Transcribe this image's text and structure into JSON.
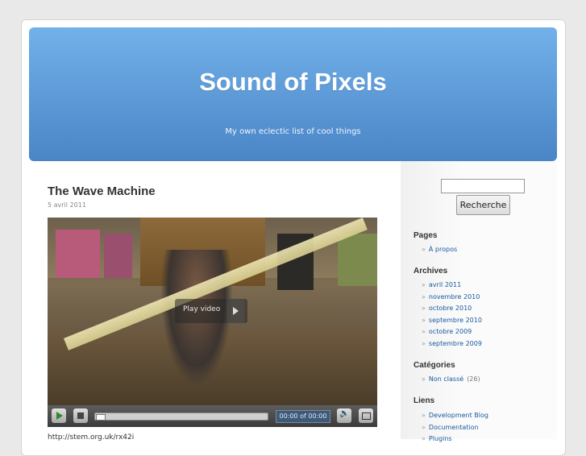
{
  "header": {
    "title": "Sound of Pixels",
    "description": "My own eclectic list of cool things",
    "gradient_top": "#72b1ea",
    "gradient_bottom": "#4a85c6"
  },
  "post": {
    "title": "The Wave Machine",
    "date": "5 avril 2011",
    "video": {
      "overlay_label": "Play video",
      "time_display": "00:00 of 00:00",
      "progress": 0
    },
    "link_text": "http://stem.org.uk/rx42i"
  },
  "sidebar": {
    "search": {
      "value": "",
      "button_label": "Recherche"
    },
    "pages": {
      "title": "Pages",
      "items": [
        {
          "label": "À propos"
        }
      ]
    },
    "archives": {
      "title": "Archives",
      "items": [
        {
          "label": "avril 2011"
        },
        {
          "label": "novembre 2010"
        },
        {
          "label": "octobre 2010"
        },
        {
          "label": "septembre 2010"
        },
        {
          "label": "octobre 2009"
        },
        {
          "label": "septembre 2009"
        }
      ]
    },
    "categories": {
      "title": "Catégories",
      "items": [
        {
          "label": "Non classé",
          "count": "(26)"
        }
      ]
    },
    "links": {
      "title": "Liens",
      "items": [
        {
          "label": "Development Blog"
        },
        {
          "label": "Documentation"
        },
        {
          "label": "Plugins"
        }
      ]
    }
  }
}
